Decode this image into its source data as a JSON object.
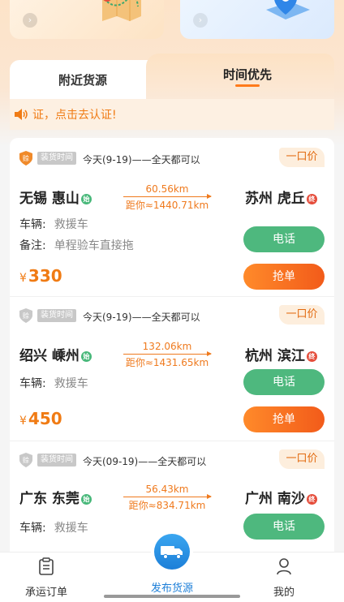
{
  "tabs": {
    "nearby": "附近货源",
    "time_priority": "时间优先"
  },
  "notice": {
    "text": "证，点击去认证!"
  },
  "orders": [
    {
      "badge_char": "赊",
      "badge_color": "#f08a2a",
      "time_tag": "装货时间",
      "time_text": "今天(9-19)——全天都可以",
      "price_type": "一口价",
      "from_city": "无锡 惠山",
      "start_mark": "始",
      "distance": "60.56km",
      "distance_to_you": "距你≈1440.71km",
      "to_city": "苏州 虎丘",
      "end_mark": "终",
      "vehicle_label": "车辆:",
      "vehicle_value": "救援车",
      "note_label": "备注:",
      "note_value": "单程验车直接拖",
      "call_label": "电话",
      "grab_label": "抢单",
      "currency": "¥",
      "price": "330"
    },
    {
      "badge_char": "赊",
      "badge_color": "#c8c8c8",
      "time_tag": "装货时间",
      "time_text": "今天(9-19)——全天都可以",
      "price_type": "一口价",
      "from_city": "绍兴 嵊州",
      "start_mark": "始",
      "distance": "132.06km",
      "distance_to_you": "距你≈1431.65km",
      "to_city": "杭州 滨江",
      "end_mark": "终",
      "vehicle_label": "车辆:",
      "vehicle_value": "救援车",
      "call_label": "电话",
      "grab_label": "抢单",
      "currency": "¥",
      "price": "450"
    },
    {
      "badge_char": "赊",
      "badge_color": "#c8c8c8",
      "time_tag": "装货时间",
      "time_text": "今天(09-19)——全天都可以",
      "price_type": "一口价",
      "from_city": "广东 东莞",
      "start_mark": "始",
      "distance": "56.43km",
      "distance_to_you": "距你≈834.71km",
      "to_city": "广州 南沙",
      "end_mark": "终",
      "vehicle_label": "车辆:",
      "vehicle_value": "救援车",
      "call_label": "电话"
    }
  ],
  "bottom_nav": {
    "orders": "承运订单",
    "publish": "发布货源",
    "mine": "我的"
  },
  "colors": {
    "accent": "#f07b14",
    "green": "#4eb87e",
    "blue": "#1d7fd8"
  }
}
